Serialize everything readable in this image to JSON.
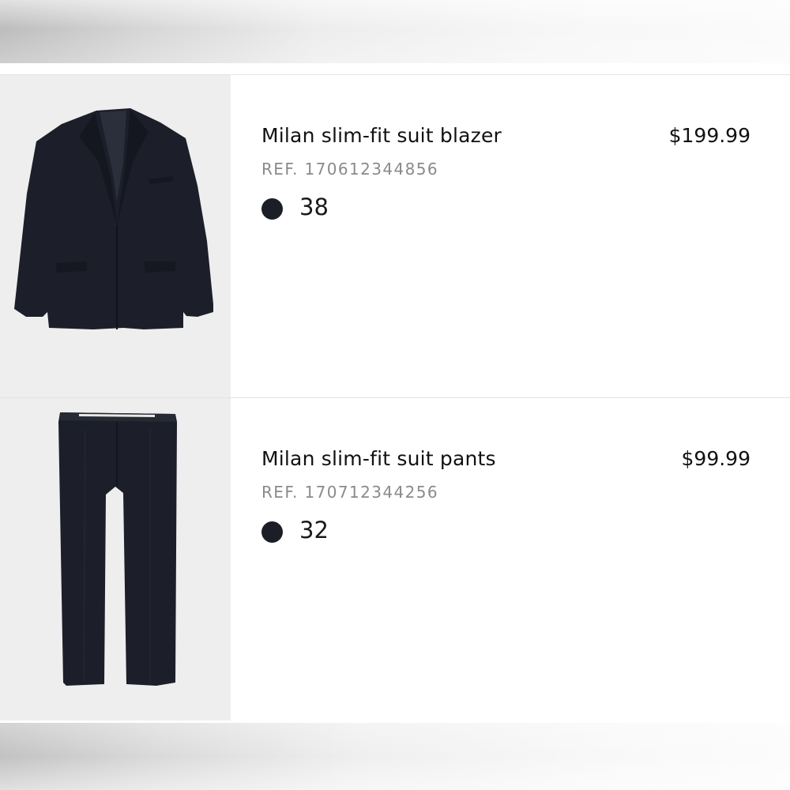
{
  "cart": {
    "items": [
      {
        "name": "Milan slim-fit suit blazer",
        "ref": "REF. 170612344856",
        "price": "$199.99",
        "size": "38",
        "color": "#1b1e27",
        "image": "blazer-image"
      },
      {
        "name": "Milan slim-fit suit pants",
        "ref": "REF. 170712344256",
        "price": "$99.99",
        "size": "32",
        "color": "#1b1e27",
        "image": "pants-image"
      }
    ]
  },
  "colors": {
    "garment": "#1b1e27",
    "thumbnail_background": "#eeeeee",
    "ref_text": "#8a8a8a"
  }
}
